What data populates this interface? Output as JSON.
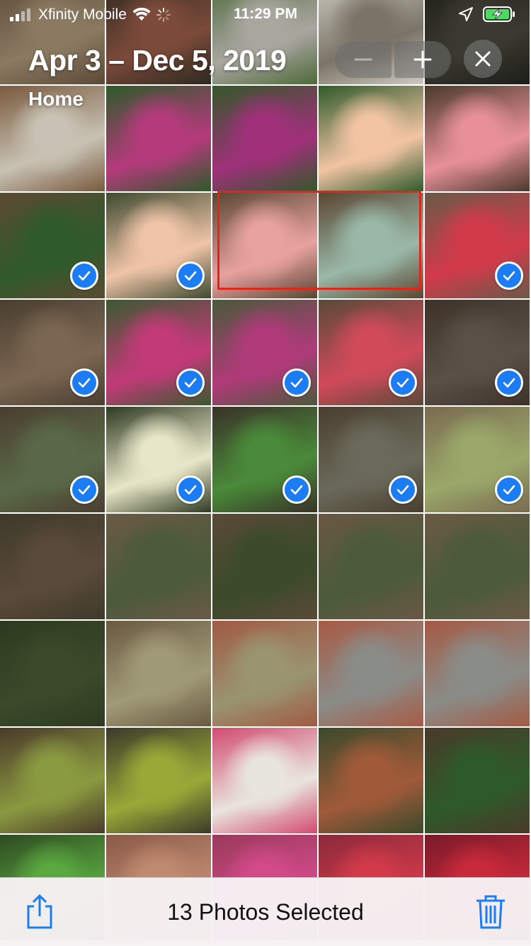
{
  "status_bar": {
    "carrier": "Xfinity Mobile",
    "time": "11:29 PM"
  },
  "header": {
    "date_range": "Apr 3 – Dec 5, 2019",
    "location": "Home"
  },
  "controls": {
    "zoom_out_icon": "minus-icon",
    "zoom_in_icon": "plus-icon",
    "close_icon": "close-icon"
  },
  "toolbar": {
    "selection_label": "13 Photos Selected",
    "share_icon": "share-icon",
    "trash_icon": "trash-icon"
  },
  "colors": {
    "accent": "#1b7cf4",
    "highlight": "#e0251b"
  },
  "photos": [
    {
      "selected": false,
      "a": "#8a7a62",
      "b": "#5b4a36"
    },
    {
      "selected": false,
      "a": "#7b4a3a",
      "b": "#2e2a20"
    },
    {
      "selected": false,
      "a": "#a9a6a0",
      "b": "#4e6a3a"
    },
    {
      "selected": false,
      "a": "#7a7468",
      "b": "#cfcac2"
    },
    {
      "selected": false,
      "a": "#3a3a30",
      "b": "#1e1e1a"
    },
    {
      "selected": false,
      "a": "#c8c2b4",
      "b": "#7a5a3e"
    },
    {
      "selected": false,
      "a": "#b53a7c",
      "b": "#2e5a2a"
    },
    {
      "selected": false,
      "a": "#a0307a",
      "b": "#34582a"
    },
    {
      "selected": false,
      "a": "#f2c4a4",
      "b": "#2f5a2a"
    },
    {
      "selected": false,
      "a": "#e8909a",
      "b": "#4a3a2a"
    },
    {
      "selected": true,
      "a": "#2f5a2a",
      "b": "#5c4a34"
    },
    {
      "selected": true,
      "a": "#f0c4a8",
      "b": "#3d4a30"
    },
    {
      "selected": false,
      "a": "#e8a2a0",
      "b": "#5a4632"
    },
    {
      "selected": false,
      "a": "#9ab8a8",
      "b": "#5a4632"
    },
    {
      "selected": true,
      "a": "#d23a4a",
      "b": "#6a5a48"
    },
    {
      "selected": true,
      "a": "#7a6652",
      "b": "#4a3e30"
    },
    {
      "selected": true,
      "a": "#c23a78",
      "b": "#3a5a30"
    },
    {
      "selected": true,
      "a": "#b03a7a",
      "b": "#4a5a3a"
    },
    {
      "selected": true,
      "a": "#d04a5a",
      "b": "#5a4a38"
    },
    {
      "selected": true,
      "a": "#5a5048",
      "b": "#3e3228"
    },
    {
      "selected": true,
      "a": "#5a6a48",
      "b": "#4a3e30"
    },
    {
      "selected": true,
      "a": "#e8e6c8",
      "b": "#2e3a22"
    },
    {
      "selected": true,
      "a": "#4a8a3a",
      "b": "#3a3228"
    },
    {
      "selected": true,
      "a": "#6a6a5a",
      "b": "#4a3e30"
    },
    {
      "selected": true,
      "a": "#9aa86a",
      "b": "#7a6a50"
    },
    {
      "selected": false,
      "a": "#5a4a3a",
      "b": "#3e3a2a"
    },
    {
      "selected": false,
      "a": "#4a5a3a",
      "b": "#6a5a44"
    },
    {
      "selected": false,
      "a": "#3a4a2a",
      "b": "#5a4a38"
    },
    {
      "selected": false,
      "a": "#4a5a3a",
      "b": "#6a5844"
    },
    {
      "selected": false,
      "a": "#4a5a3a",
      "b": "#6a5a44"
    },
    {
      "selected": false,
      "a": "#3a4a2a",
      "b": "#2e3a20"
    },
    {
      "selected": false,
      "a": "#a09a78",
      "b": "#6a5a40"
    },
    {
      "selected": false,
      "a": "#9a9470",
      "b": "#a05a44"
    },
    {
      "selected": false,
      "a": "#8a8c88",
      "b": "#a85a44"
    },
    {
      "selected": false,
      "a": "#8a8c88",
      "b": "#a45a44"
    },
    {
      "selected": false,
      "a": "#8a9a40",
      "b": "#4a3a2a"
    },
    {
      "selected": false,
      "a": "#9aa838",
      "b": "#3a3a2a"
    },
    {
      "selected": false,
      "a": "#e8e4de",
      "b": "#d24a70"
    },
    {
      "selected": false,
      "a": "#a05a3a",
      "b": "#3a4a2a"
    },
    {
      "selected": false,
      "a": "#2e5a2a",
      "b": "#4a3a2a"
    },
    {
      "selected": false,
      "a": "#5aa840",
      "b": "#2e4a22"
    },
    {
      "selected": false,
      "a": "#c08a70",
      "b": "#8a5a48"
    },
    {
      "selected": false,
      "a": "#d24a8a",
      "b": "#9a3a5a"
    },
    {
      "selected": false,
      "a": "#d23a4a",
      "b": "#8a2a3a"
    },
    {
      "selected": false,
      "a": "#c82a3a",
      "b": "#7a1a2a"
    }
  ]
}
